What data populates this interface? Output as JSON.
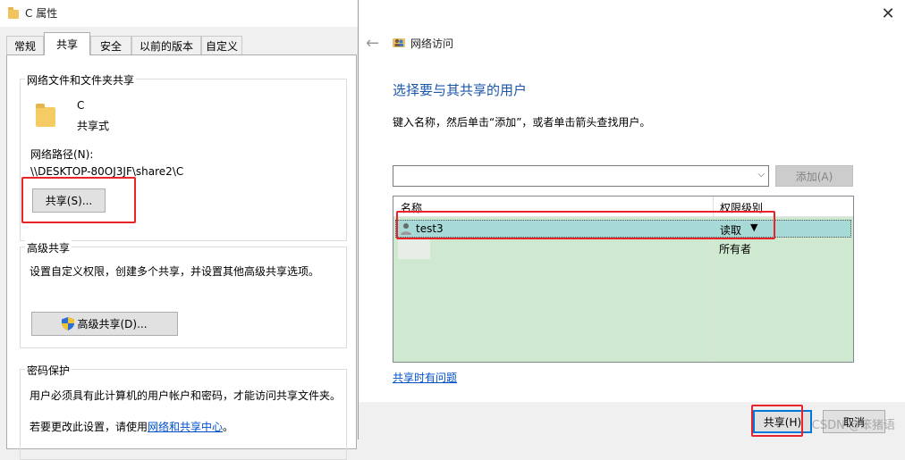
{
  "properties_window": {
    "title": "C 属性",
    "tabs": [
      {
        "label": "常规"
      },
      {
        "label": "共享"
      },
      {
        "label": "安全"
      },
      {
        "label": "以前的版本"
      },
      {
        "label": "自定义"
      }
    ],
    "network_share": {
      "group_label": "网络文件和文件夹共享",
      "folder_name": "C",
      "share_status": "共享式",
      "path_label": "网络路径(N):",
      "path_value": "\\\\DESKTOP-80OJ3JF\\share2\\C",
      "share_button": "共享(S)..."
    },
    "advanced_share": {
      "group_label": "高级共享",
      "description": "设置自定义权限，创建多个共享，并设置其他高级共享选项。",
      "button": "高级共享(D)..."
    },
    "password_protection": {
      "group_label": "密码保护",
      "description": "用户必须具有此计算机的用户帐户和密码，才能访问共享文件夹。",
      "change_prefix": "若要更改此设置，请使用",
      "change_link": "网络和共享中心",
      "change_suffix": "。"
    }
  },
  "network_access_dialog": {
    "title": "网络访问",
    "heading": "选择要与其共享的用户",
    "instructions": "键入名称，然后单击“添加”，或者单击箭头查找用户。",
    "combo_value": "",
    "add_button": "添加(A)",
    "columns": [
      "名称",
      "权限级别"
    ],
    "rows": [
      {
        "name": "test3",
        "permission": "读取",
        "selected": true
      },
      {
        "name": "",
        "permission": "所有者",
        "selected": false
      }
    ],
    "help_link": "共享时有问题",
    "share_button": "共享(H)",
    "cancel_button": "取消"
  },
  "watermark": "CSDN @笨猪语",
  "colors": {
    "heading_blue": "#1b57a8",
    "link_blue": "#0050c8",
    "list_background": "#cfe8d0",
    "selected_row": "#a7d9d6",
    "highlight_red": "#e8242a"
  }
}
